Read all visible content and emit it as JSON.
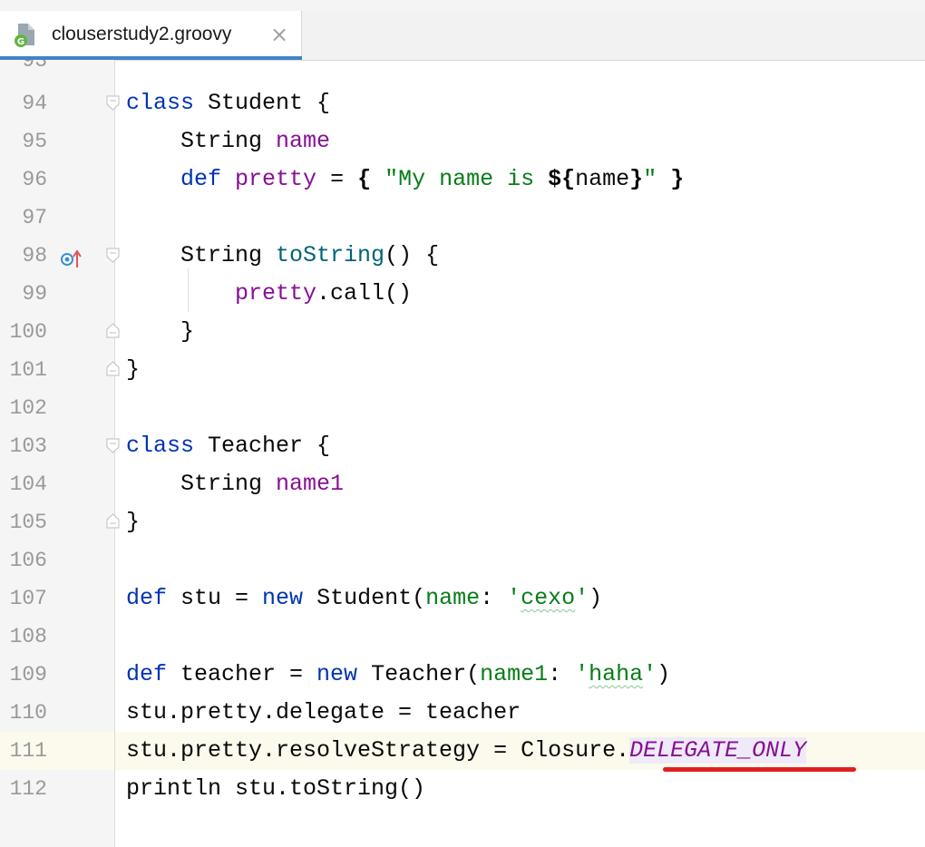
{
  "tab": {
    "filename": "clouserstudy2.groovy",
    "close": "×"
  },
  "editor": {
    "first_partial_line": "93",
    "lines": [
      {
        "num": "94",
        "code": "class Student {"
      },
      {
        "num": "95",
        "code": "    String name"
      },
      {
        "num": "96",
        "code": "    def pretty = { \"My name is ${name}\" }"
      },
      {
        "num": "97",
        "code": ""
      },
      {
        "num": "98",
        "code": "    String toString() {"
      },
      {
        "num": "99",
        "code": "        pretty.call()"
      },
      {
        "num": "100",
        "code": "    }"
      },
      {
        "num": "101",
        "code": "}"
      },
      {
        "num": "102",
        "code": ""
      },
      {
        "num": "103",
        "code": "class Teacher {"
      },
      {
        "num": "104",
        "code": "    String name1"
      },
      {
        "num": "105",
        "code": "}"
      },
      {
        "num": "106",
        "code": ""
      },
      {
        "num": "107",
        "code": "def stu = new Student(name: 'cexo')"
      },
      {
        "num": "108",
        "code": ""
      },
      {
        "num": "109",
        "code": "def teacher = new Teacher(name1: 'haha')"
      },
      {
        "num": "110",
        "code": "stu.pretty.delegate = teacher"
      },
      {
        "num": "111",
        "code": "stu.pretty.resolveStrategy = Closure.DELEGATE_ONLY"
      },
      {
        "num": "112",
        "code": "println stu.toString()"
      }
    ],
    "current_line": "111"
  },
  "tokens": {
    "l94": [
      "class",
      " Student {"
    ],
    "l95": [
      "    String ",
      "name"
    ],
    "l96": [
      "    ",
      "def",
      " ",
      "pretty",
      " = ",
      "{",
      " ",
      "\"My name is ",
      "${",
      "name",
      "}",
      "\"",
      " ",
      "}"
    ],
    "l98": [
      "    String ",
      "toString",
      "() {"
    ],
    "l99": [
      "        ",
      "pretty",
      ".call()"
    ],
    "l100": [
      "    }"
    ],
    "l101": [
      "}"
    ],
    "l103": [
      "class",
      " Teacher {"
    ],
    "l104": [
      "    String ",
      "name1"
    ],
    "l105": [
      "}"
    ],
    "l107": [
      "def",
      " stu = ",
      "new",
      " Student(",
      "name",
      ": ",
      "'",
      "cexo",
      "'",
      ")"
    ],
    "l109": [
      "def",
      " teacher = ",
      "new",
      " Teacher(",
      "name1",
      ": ",
      "'",
      "haha",
      "'",
      ")"
    ],
    "l110": [
      "stu.pretty.delegate = teacher"
    ],
    "l111": [
      "stu.pretty.resolveStrategy = Closure.",
      "DELEGATE_ONLY"
    ],
    "l112": [
      "println stu.toString()"
    ]
  },
  "colors": {
    "keyword": "#0033b3",
    "field": "#871094",
    "string": "#067d17",
    "method": "#00627a",
    "annotation_underline": "#e02020"
  }
}
